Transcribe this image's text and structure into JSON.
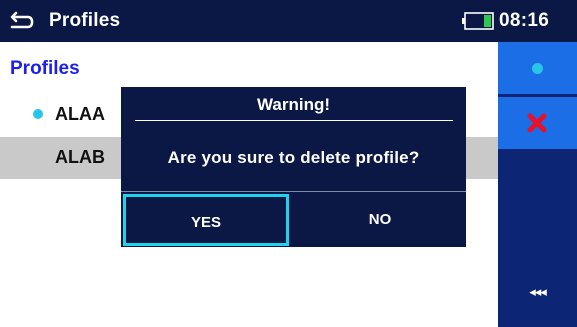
{
  "topbar": {
    "title": "Profiles",
    "time": "08:16",
    "back_icon": "back-arrow-icon",
    "battery_icon": "battery-icon"
  },
  "main": {
    "section_title": "Profiles",
    "profiles": [
      {
        "label": "ALAA",
        "active": true,
        "selected": false
      },
      {
        "label": "ALAB",
        "active": false,
        "selected": true
      }
    ]
  },
  "sidebar": {
    "buttons": [
      {
        "icon": "dot-icon",
        "accent": "#27c6e8"
      },
      {
        "icon": "delete-x-icon",
        "accent": "#e8102a"
      }
    ],
    "back_label": "◂◂◂"
  },
  "dialog": {
    "title": "Warning!",
    "message": "Are you sure to delete profile?",
    "yes_label": "YES",
    "no_label": "NO"
  },
  "colors": {
    "navy": "#0b1845",
    "sidebar_blue": "#0c2675",
    "button_blue": "#1b6ee6",
    "title_blue": "#1d1ff0",
    "cyan_focus": "#1fd3ec",
    "selected_row": "#c9c9c9"
  }
}
